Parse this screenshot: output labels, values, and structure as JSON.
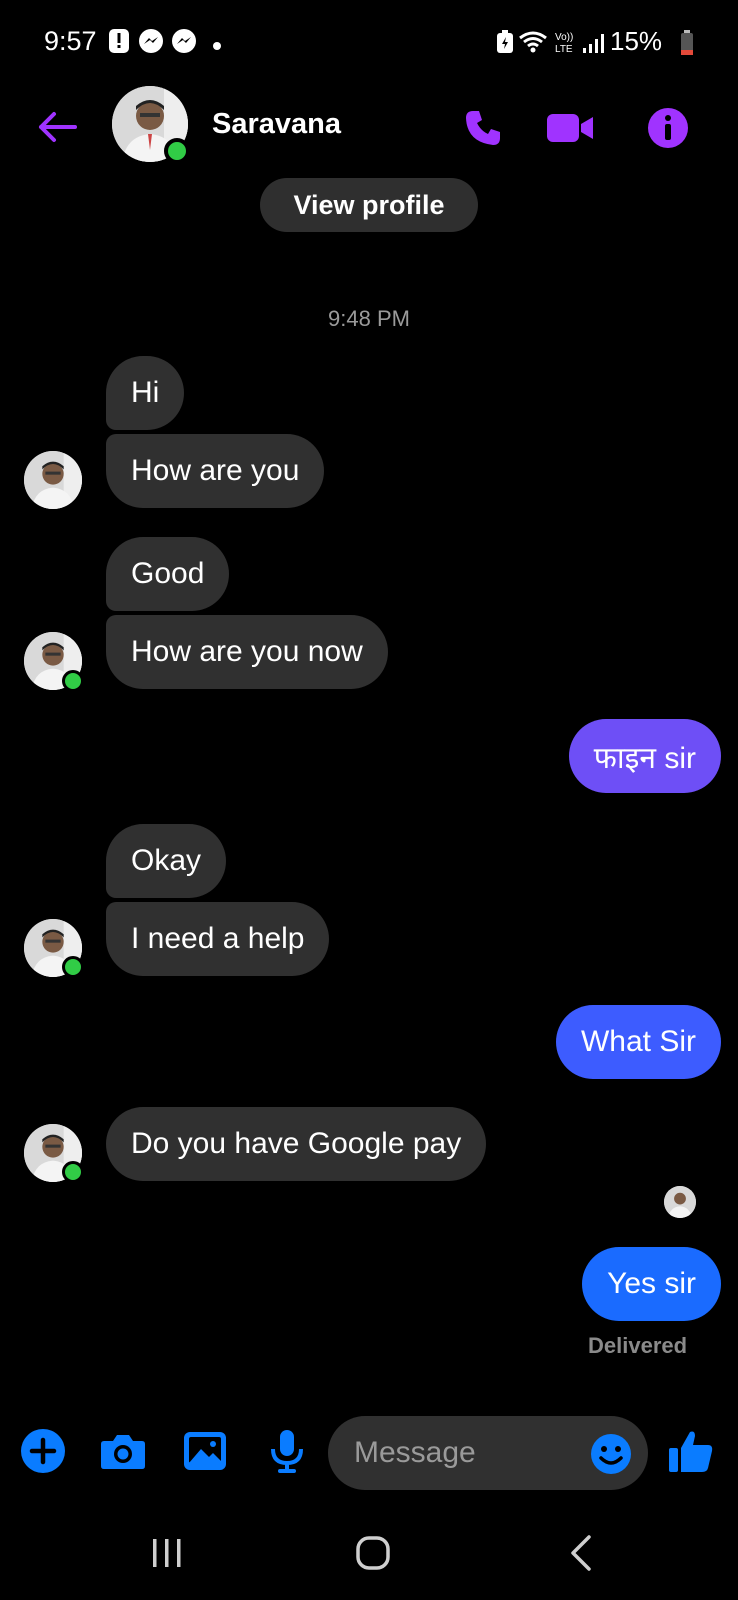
{
  "status_bar": {
    "time": "9:57",
    "battery": "15%",
    "icons": [
      "alert-icon",
      "messenger-icon",
      "messenger-icon",
      "dot-icon",
      "battery-saver-icon",
      "wifi-icon",
      "volte-icon",
      "signal-icon",
      "battery-icon"
    ]
  },
  "header": {
    "contact_name": "Saravana",
    "back_icon": "arrow-left-icon",
    "call_icon": "phone-icon",
    "video_icon": "video-camera-icon",
    "info_icon": "info-icon",
    "accent_color": "#a033ff"
  },
  "thread": {
    "view_profile_label": "View profile",
    "timestamp": "9:48 PM",
    "messages": [
      {
        "side": "in",
        "text": "Hi"
      },
      {
        "side": "in",
        "text": "How are you"
      },
      {
        "side": "in",
        "text": "Good"
      },
      {
        "side": "in",
        "text": "How are you now"
      },
      {
        "side": "out",
        "text": "फाइन sir",
        "color": "#6e4ff6"
      },
      {
        "side": "in",
        "text": "Okay"
      },
      {
        "side": "in",
        "text": "I need a help"
      },
      {
        "side": "out",
        "text": "What Sir",
        "color": "#3d5cff"
      },
      {
        "side": "in",
        "text": "Do you have Google pay"
      },
      {
        "side": "out",
        "text": "Yes sir",
        "color": "#1a6bff"
      }
    ],
    "delivery_status": "Delivered"
  },
  "composer": {
    "placeholder": "Message",
    "accent_color": "#0a7cff",
    "icons": [
      "plus-icon",
      "camera-icon",
      "image-icon",
      "microphone-icon",
      "emoji-icon",
      "thumbs-up-icon"
    ]
  },
  "nav": {
    "icons": [
      "recent-apps-icon",
      "home-icon",
      "back-icon"
    ]
  }
}
